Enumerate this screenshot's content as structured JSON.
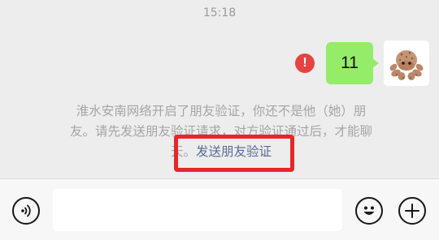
{
  "chat": {
    "timestamp": "15:18",
    "message": {
      "text": "11",
      "status_icon": "error-icon",
      "status_color": "#e64340",
      "bubble_color": "#95ec69"
    },
    "avatar": {
      "icon": "octopus-avatar"
    },
    "system_notice": {
      "line1": "淮水安南网络开启了朋友验证，你还不是他（她）朋",
      "line2": "友。请先发送朋友验证请求，对方验证通过后，才能聊",
      "line3_prefix": "天。",
      "link_text": "发送朋友验证",
      "link_color": "#576b95",
      "highlight_color": "#e8262a"
    }
  },
  "input_bar": {
    "voice_icon": "voice-icon",
    "text_value": "",
    "emoji_icon": "emoji-icon",
    "plus_icon": "plus-icon"
  }
}
